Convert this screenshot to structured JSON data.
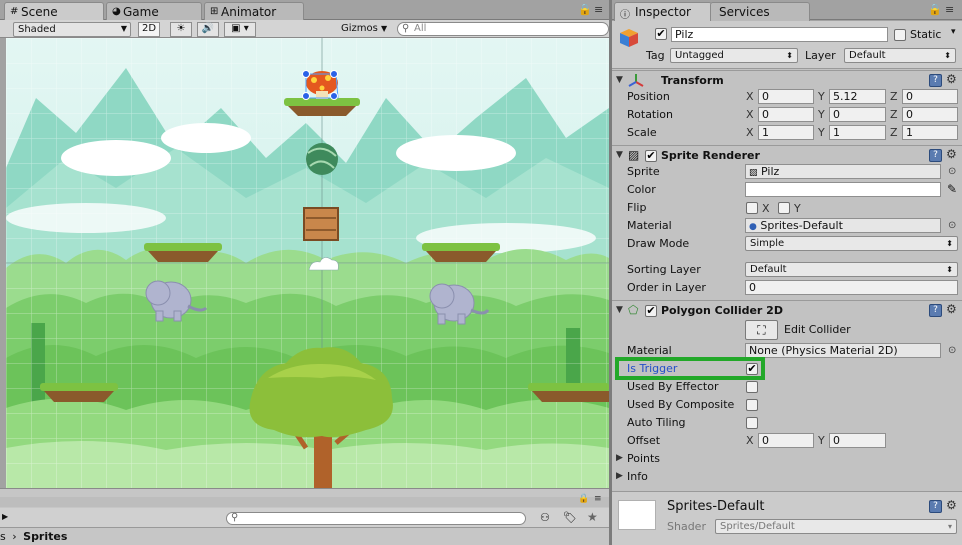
{
  "scene_window": {
    "tabs": [
      {
        "label": "Scene",
        "icon": "hash-icon"
      },
      {
        "label": "Game",
        "icon": "pacman-icon"
      },
      {
        "label": "Animator",
        "icon": "animator-icon"
      }
    ],
    "toolbar": {
      "shading_mode": "Shaded",
      "mode_2d": "2D",
      "gizmos_label": "Gizmos",
      "search_placeholder": "All"
    }
  },
  "project_bar": {
    "breadcrumb_prefix": "s",
    "breadcrumb_separator": "›",
    "breadcrumb_current": "Sprites"
  },
  "inspector": {
    "tabs": [
      {
        "label": "Inspector",
        "icon": "info-icon"
      },
      {
        "label": "Services"
      }
    ],
    "gameobject": {
      "name": "Pilz",
      "static_label": "Static",
      "tag_label": "Tag",
      "tag_value": "Untagged",
      "layer_label": "Layer",
      "layer_value": "Default"
    },
    "transform": {
      "title": "Transform",
      "position_label": "Position",
      "position": {
        "x": "0",
        "y": "5.12",
        "z": "0"
      },
      "rotation_label": "Rotation",
      "rotation": {
        "x": "0",
        "y": "0",
        "z": "0"
      },
      "scale_label": "Scale",
      "scale": {
        "x": "1",
        "y": "1",
        "z": "1"
      },
      "axis_x": "X",
      "axis_y": "Y",
      "axis_z": "Z"
    },
    "sprite_renderer": {
      "title": "Sprite Renderer",
      "sprite_label": "Sprite",
      "sprite_value": "Pilz",
      "color_label": "Color",
      "flip_label": "Flip",
      "flip_x": "X",
      "flip_y": "Y",
      "material_label": "Material",
      "material_value": "Sprites-Default",
      "draw_mode_label": "Draw Mode",
      "draw_mode_value": "Simple",
      "sorting_layer_label": "Sorting Layer",
      "sorting_layer_value": "Default",
      "order_label": "Order in Layer",
      "order_value": "0"
    },
    "polygon_collider": {
      "title": "Polygon Collider 2D",
      "edit_collider_label": "Edit Collider",
      "material_label": "Material",
      "material_value": "None (Physics Material 2D)",
      "is_trigger_label": "Is Trigger",
      "used_by_effector_label": "Used By Effector",
      "used_by_composite_label": "Used By Composite",
      "auto_tiling_label": "Auto Tiling",
      "offset_label": "Offset",
      "offset": {
        "x": "0",
        "y": "0"
      },
      "points_label": "Points",
      "info_label": "Info"
    },
    "material_asset": {
      "name": "Sprites-Default",
      "shader_label": "Shader",
      "shader_value": "Sprites/Default"
    }
  },
  "colors": {
    "highlight_box": "#22a829",
    "trigger_label": "#2450c8",
    "panel_bg": "#c2c2c2",
    "editor_bg": "#a2a2a2"
  }
}
